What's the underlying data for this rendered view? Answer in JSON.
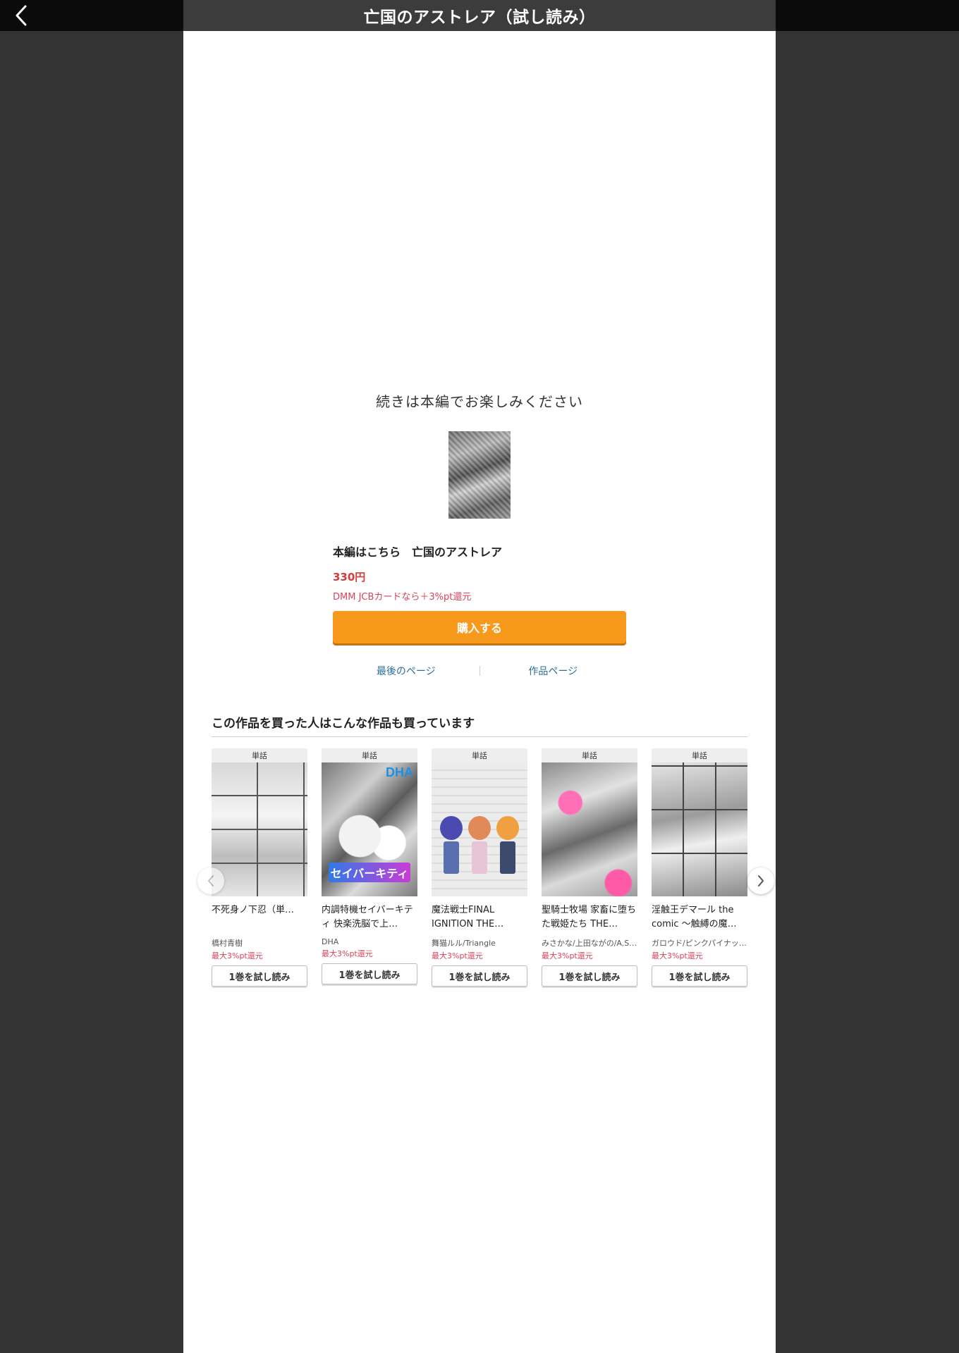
{
  "header": {
    "title": "亡国のアストレア（試し読み）",
    "back_icon": "chevron-left-icon"
  },
  "end_panel": {
    "message": "続きは本編でお楽しみください",
    "product_name": "本編はこちら　亡国のアストレア",
    "price": "330円",
    "jcb_note": "DMM JCBカードなら＋3%pt還元",
    "buy_label": "購入する",
    "buy_color": "#f79a1c",
    "last_page_label": "最後のページ",
    "work_page_label": "作品ページ"
  },
  "recommendations": {
    "heading": "この作品を買った人はこんな作品も買っています",
    "items": [
      {
        "badge": "単話",
        "name": "不死身ノ下忍（単…",
        "author": "橋村青樹",
        "pt": "最大3%pt還元",
        "button": "1巻を試し読み"
      },
      {
        "badge": "単話",
        "name": "内調特機セイバーキティ 快楽洗脳で上…",
        "author": "DHA",
        "pt": "最大3%pt還元",
        "button": "1巻を試し読み",
        "logo_text": "DHA",
        "cover_title": "セイバーキティ"
      },
      {
        "badge": "単話",
        "name": "魔法戦士FINAL IGNITION THE…",
        "author": "舞猫ルル/Triangle",
        "pt": "最大3%pt還元",
        "button": "1巻を試し読み"
      },
      {
        "badge": "単話",
        "name": "聖騎士牧場 家畜に堕ちた戦姫たち THE…",
        "author": "みさかな/上田ながの/A.S…",
        "pt": "最大3%pt還元",
        "button": "1巻を試し読み"
      },
      {
        "badge": "単話",
        "name": "淫触王デマール the comic ～触縛の魔…",
        "author": "ガロウド/ピンクパイナッ…",
        "pt": "最大3%pt還元",
        "button": "1巻を試し読み"
      }
    ]
  }
}
